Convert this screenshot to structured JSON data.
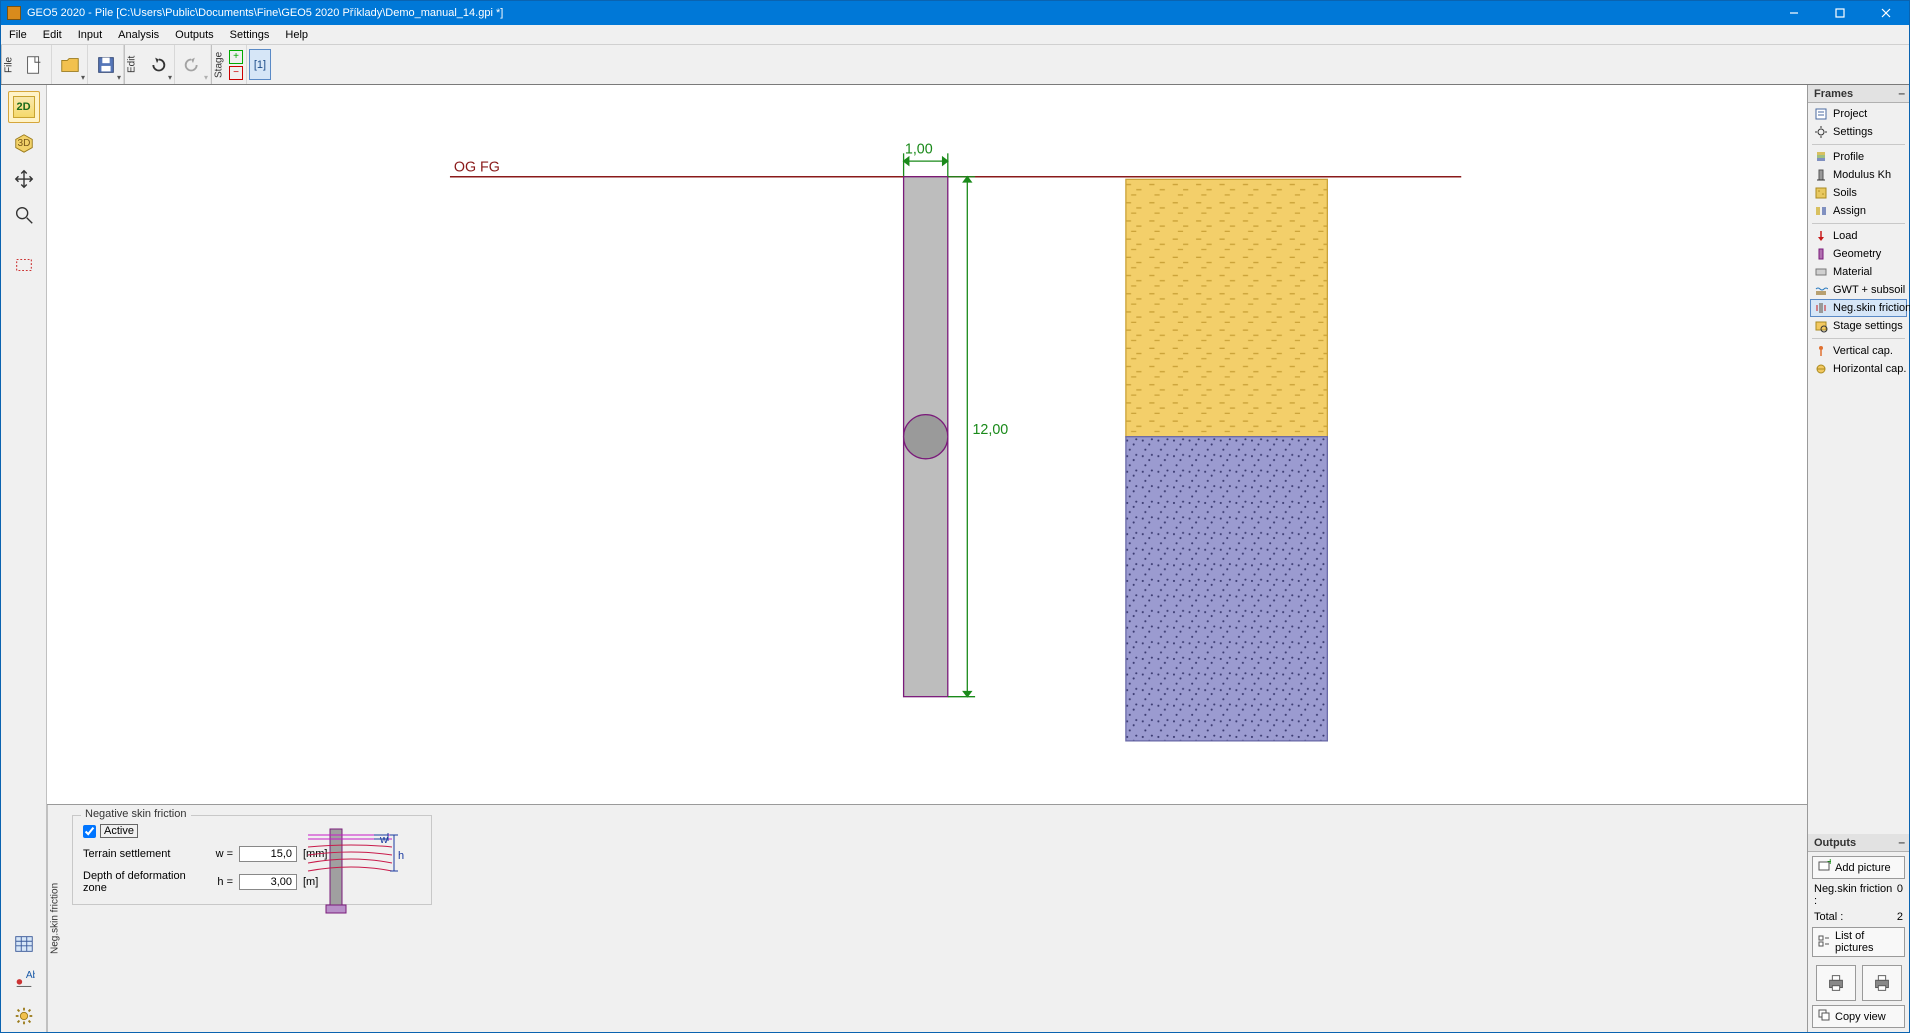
{
  "titlebar": {
    "title": "GEO5 2020 - Pile [C:\\Users\\Public\\Documents\\Fine\\GEO5 2020 Příklady\\Demo_manual_14.gpi *]"
  },
  "menu": {
    "items": [
      "File",
      "Edit",
      "Input",
      "Analysis",
      "Outputs",
      "Settings",
      "Help"
    ]
  },
  "toolbar": {
    "file_tab": "File",
    "edit_tab": "Edit",
    "stage_tab": "Stage",
    "stage_number": "[1]"
  },
  "left_tools": {
    "btn2d": "2D",
    "btn3d": "3D"
  },
  "canvas": {
    "top_dim": "1,00",
    "side_dim": "12,00",
    "og_label": "OG FG"
  },
  "bottom": {
    "side_label": "Neg.skin friction",
    "group_title": "Negative skin friction",
    "active_label": "Active",
    "row1_label": "Terrain settlement",
    "row1_sym": "w =",
    "row1_val": "15,0",
    "row1_unit": "[mm]",
    "row2_label": "Depth of deformation zone",
    "row2_sym": "h =",
    "row2_val": "3,00",
    "row2_unit": "[m]",
    "diag_w": "w",
    "diag_h": "h"
  },
  "frames": {
    "header": "Frames",
    "items": [
      {
        "label": "Project",
        "icon": "project"
      },
      {
        "label": "Settings",
        "icon": "gear"
      },
      {
        "label": "Profile",
        "icon": "profile"
      },
      {
        "label": "Modulus Kh",
        "icon": "modulus"
      },
      {
        "label": "Soils",
        "icon": "soils"
      },
      {
        "label": "Assign",
        "icon": "assign"
      },
      {
        "label": "Load",
        "icon": "load"
      },
      {
        "label": "Geometry",
        "icon": "geometry"
      },
      {
        "label": "Material",
        "icon": "material"
      },
      {
        "label": "GWT + subsoil",
        "icon": "gwt"
      },
      {
        "label": "Neg.skin friction",
        "icon": "neg",
        "selected": true
      },
      {
        "label": "Stage settings",
        "icon": "stageset"
      },
      {
        "label": "Vertical cap.",
        "icon": "vert"
      },
      {
        "label": "Horizontal cap.",
        "icon": "horiz"
      }
    ]
  },
  "outputs": {
    "header": "Outputs",
    "add_picture": "Add picture",
    "row1_label": "Neg.skin friction :",
    "row1_val": "0",
    "row2_label": "Total :",
    "row2_val": "2",
    "list_pictures": "List of pictures",
    "copy_view": "Copy view"
  }
}
